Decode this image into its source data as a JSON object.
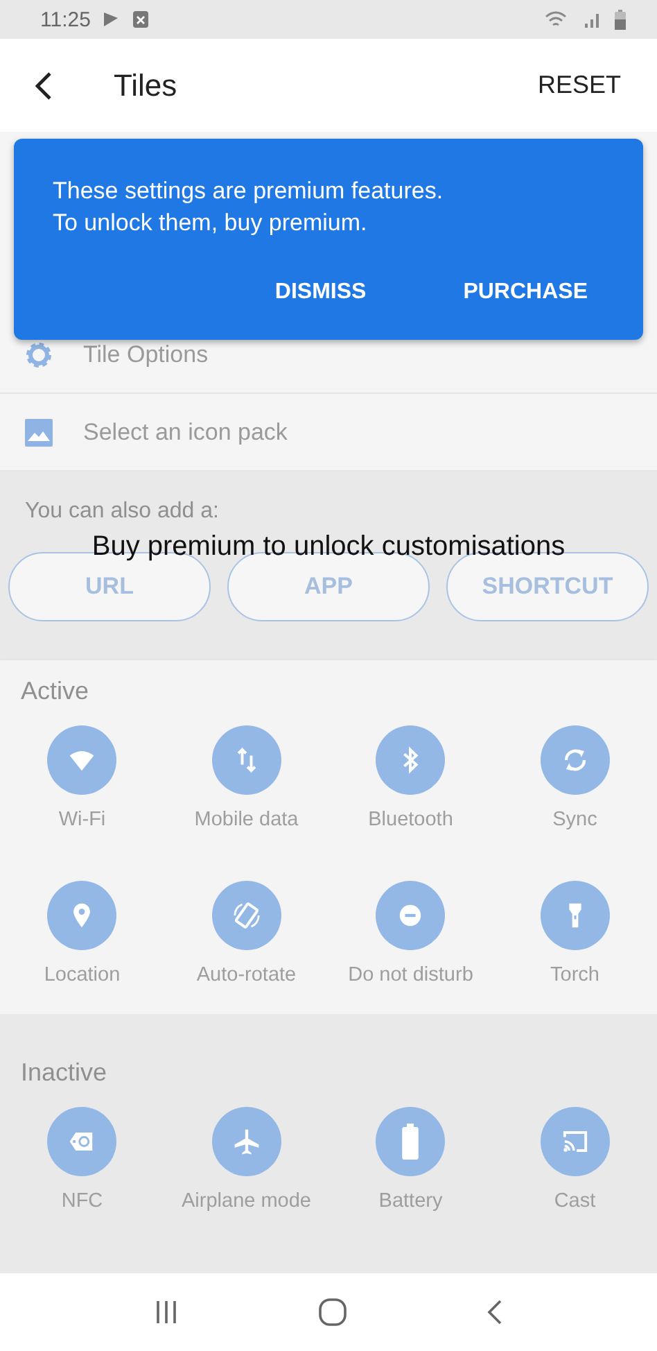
{
  "status_bar": {
    "time": "11:25"
  },
  "app_bar": {
    "title": "Tiles",
    "action": "RESET"
  },
  "banner": {
    "message": "These settings are premium features.\nTo unlock them, buy premium.",
    "buttons": [
      "DISMISS",
      "PURCHASE"
    ]
  },
  "options": [
    "Tile Options",
    "Select an icon pack"
  ],
  "add_section": {
    "label": "You can also add a:",
    "overlay": "Buy premium to unlock customisations",
    "buttons": [
      "URL",
      "APP",
      "SHORTCUT"
    ]
  },
  "active": {
    "title": "Active",
    "tiles": [
      "Wi-Fi",
      "Mobile data",
      "Bluetooth",
      "Sync",
      "Location",
      "Auto-rotate",
      "Do not disturb",
      "Torch"
    ]
  },
  "inactive": {
    "title": "Inactive",
    "tiles": [
      "NFC",
      "Airplane mode",
      "Battery",
      "Cast"
    ]
  }
}
